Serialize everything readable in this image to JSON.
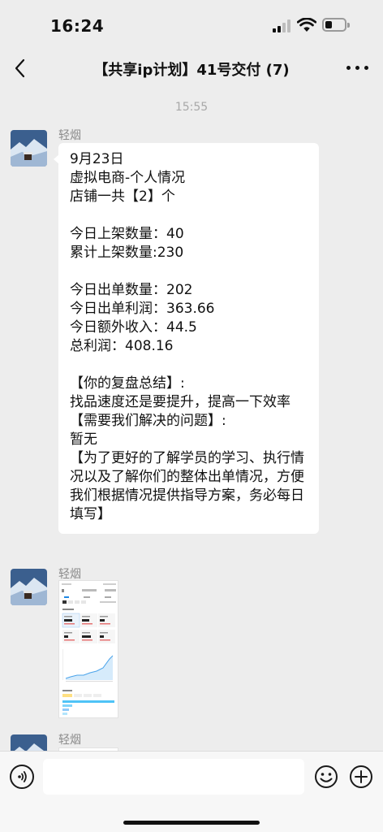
{
  "status_bar": {
    "time": "16:24"
  },
  "nav": {
    "title": "【共享ip计划】41号交付 (7)"
  },
  "timestamp": "15:55",
  "messages": [
    {
      "sender": "轻烟",
      "type": "text",
      "text": "9月23日\n虚拟电商-个人情况\n店铺一共【2】个\n\n今日上架数量：40\n累计上架数量:230\n\n今日出单数量：202\n今日出单利润：363.66\n今日额外收入：44.5\n总利润：408.16\n\n【你的复盘总结】:\n找品速度还是要提升，提高一下效率\n【需要我们解决的问题】:\n暂无\n【为了更好的了解学员的学习、执行情况以及了解你们的整体出单情况，方便我们根据情况提供指导方案，务必每日填写】"
    },
    {
      "sender": "轻烟",
      "type": "image"
    },
    {
      "sender": "轻烟",
      "type": "image"
    }
  ],
  "icons": {
    "back": "chevron-left-icon",
    "more": "more-dots-icon",
    "voice": "voice-icon",
    "emoji": "emoji-icon",
    "plus": "plus-icon"
  },
  "colors": {
    "background": "#ededed",
    "bubble": "#ffffff",
    "input_bar": "#f7f7f7"
  }
}
